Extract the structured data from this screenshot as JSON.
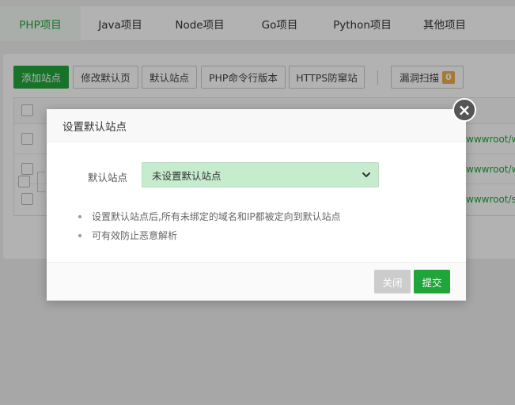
{
  "tabs": [
    {
      "label": "PHP项目",
      "active": true
    },
    {
      "label": "Java项目"
    },
    {
      "label": "Node项目"
    },
    {
      "label": "Go项目"
    },
    {
      "label": "Python项目"
    },
    {
      "label": "其他项目"
    }
  ],
  "toolbar": {
    "add_site": "添加站点",
    "edit_default_page": "修改默认页",
    "default_site": "默认站点",
    "php_cli_version": "PHP命令行版本",
    "https_protection": "HTTPS防窜站",
    "vuln_scan": "漏洞扫描",
    "vuln_count": "0"
  },
  "table": {
    "row_paths": [
      "wwwroot/w",
      "wwwroot/w",
      "wwwroot/s"
    ]
  },
  "modal": {
    "title": "设置默认站点",
    "field_label": "默认站点",
    "select_value": "未设置默认站点",
    "tips": [
      "设置默认站点后,所有未绑定的域名和IP都被定向到默认站点",
      "可有效防止恶意解析"
    ],
    "close_label": "关闭",
    "submit_label": "提交"
  },
  "colors": {
    "brand": "#20a53a",
    "badge": "#f0ad4e",
    "select_bg": "#c6ecce"
  }
}
